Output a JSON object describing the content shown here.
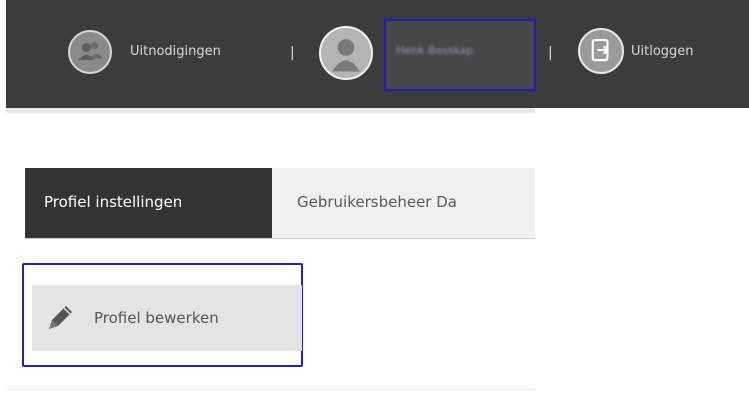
{
  "header": {
    "invitations_label": "Uitnodigingen",
    "separator": "|",
    "username": "Henk Bosskap",
    "logout_label": "Uitloggen"
  },
  "tabs": [
    {
      "label": "Profiel instellingen",
      "active": true
    },
    {
      "label": "Gebruikersbeheer Da",
      "active": false
    }
  ],
  "actions": {
    "edit_profile_label": "Profiel bewerken"
  },
  "icons": {
    "invitations": "group-icon",
    "user": "user-avatar-icon",
    "logout": "logout-icon",
    "edit": "pencil-icon"
  },
  "colors": {
    "topbar_bg": "#3c3c3c",
    "active_tab_bg": "#333333",
    "highlight_border": "#1d1dbb"
  }
}
